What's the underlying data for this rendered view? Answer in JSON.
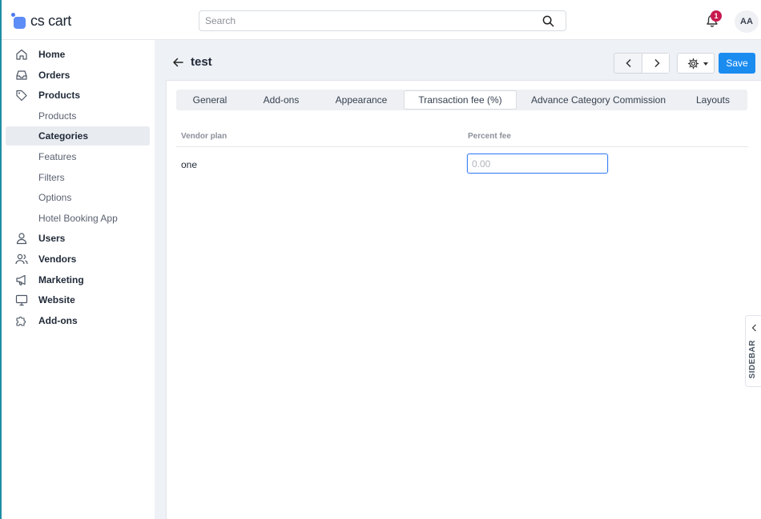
{
  "app": {
    "logo_text": "cs cart"
  },
  "header": {
    "search_placeholder": "Search",
    "notifications_count": "1",
    "avatar_initials": "AA"
  },
  "sidebar": {
    "items": [
      {
        "label": "Home",
        "icon": "home-icon"
      },
      {
        "label": "Orders",
        "icon": "inbox-icon"
      },
      {
        "label": "Products",
        "icon": "tag-icon"
      },
      {
        "label": "Products",
        "icon": ""
      },
      {
        "label": "Categories",
        "icon": ""
      },
      {
        "label": "Features",
        "icon": ""
      },
      {
        "label": "Filters",
        "icon": ""
      },
      {
        "label": "Options",
        "icon": ""
      },
      {
        "label": "Hotel Booking App",
        "icon": ""
      },
      {
        "label": "Users",
        "icon": "user-icon"
      },
      {
        "label": "Vendors",
        "icon": "users-icon"
      },
      {
        "label": "Marketing",
        "icon": "megaphone-icon"
      },
      {
        "label": "Website",
        "icon": "monitor-icon"
      },
      {
        "label": "Add-ons",
        "icon": "puzzle-icon"
      }
    ],
    "active_item": "Categories"
  },
  "page": {
    "title": "test",
    "save_label": "Save"
  },
  "tabs": [
    {
      "label": "General"
    },
    {
      "label": "Add-ons"
    },
    {
      "label": "Appearance"
    },
    {
      "label": "Transaction fee (%)"
    },
    {
      "label": "Advance Category Commission"
    },
    {
      "label": "Layouts"
    }
  ],
  "active_tab": "Transaction fee (%)",
  "table": {
    "columns": [
      "Vendor plan",
      "Percent fee"
    ],
    "rows": [
      {
        "vendor_plan": "one",
        "percent_fee": "",
        "percent_fee_placeholder": "0.00"
      }
    ]
  },
  "right_panel": {
    "label": "SIDEBAR"
  },
  "colors": {
    "accent": "#1a8cf0",
    "badge": "#c8184e",
    "main_bg": "#eef1f6",
    "frame": "#1f8ea6"
  }
}
